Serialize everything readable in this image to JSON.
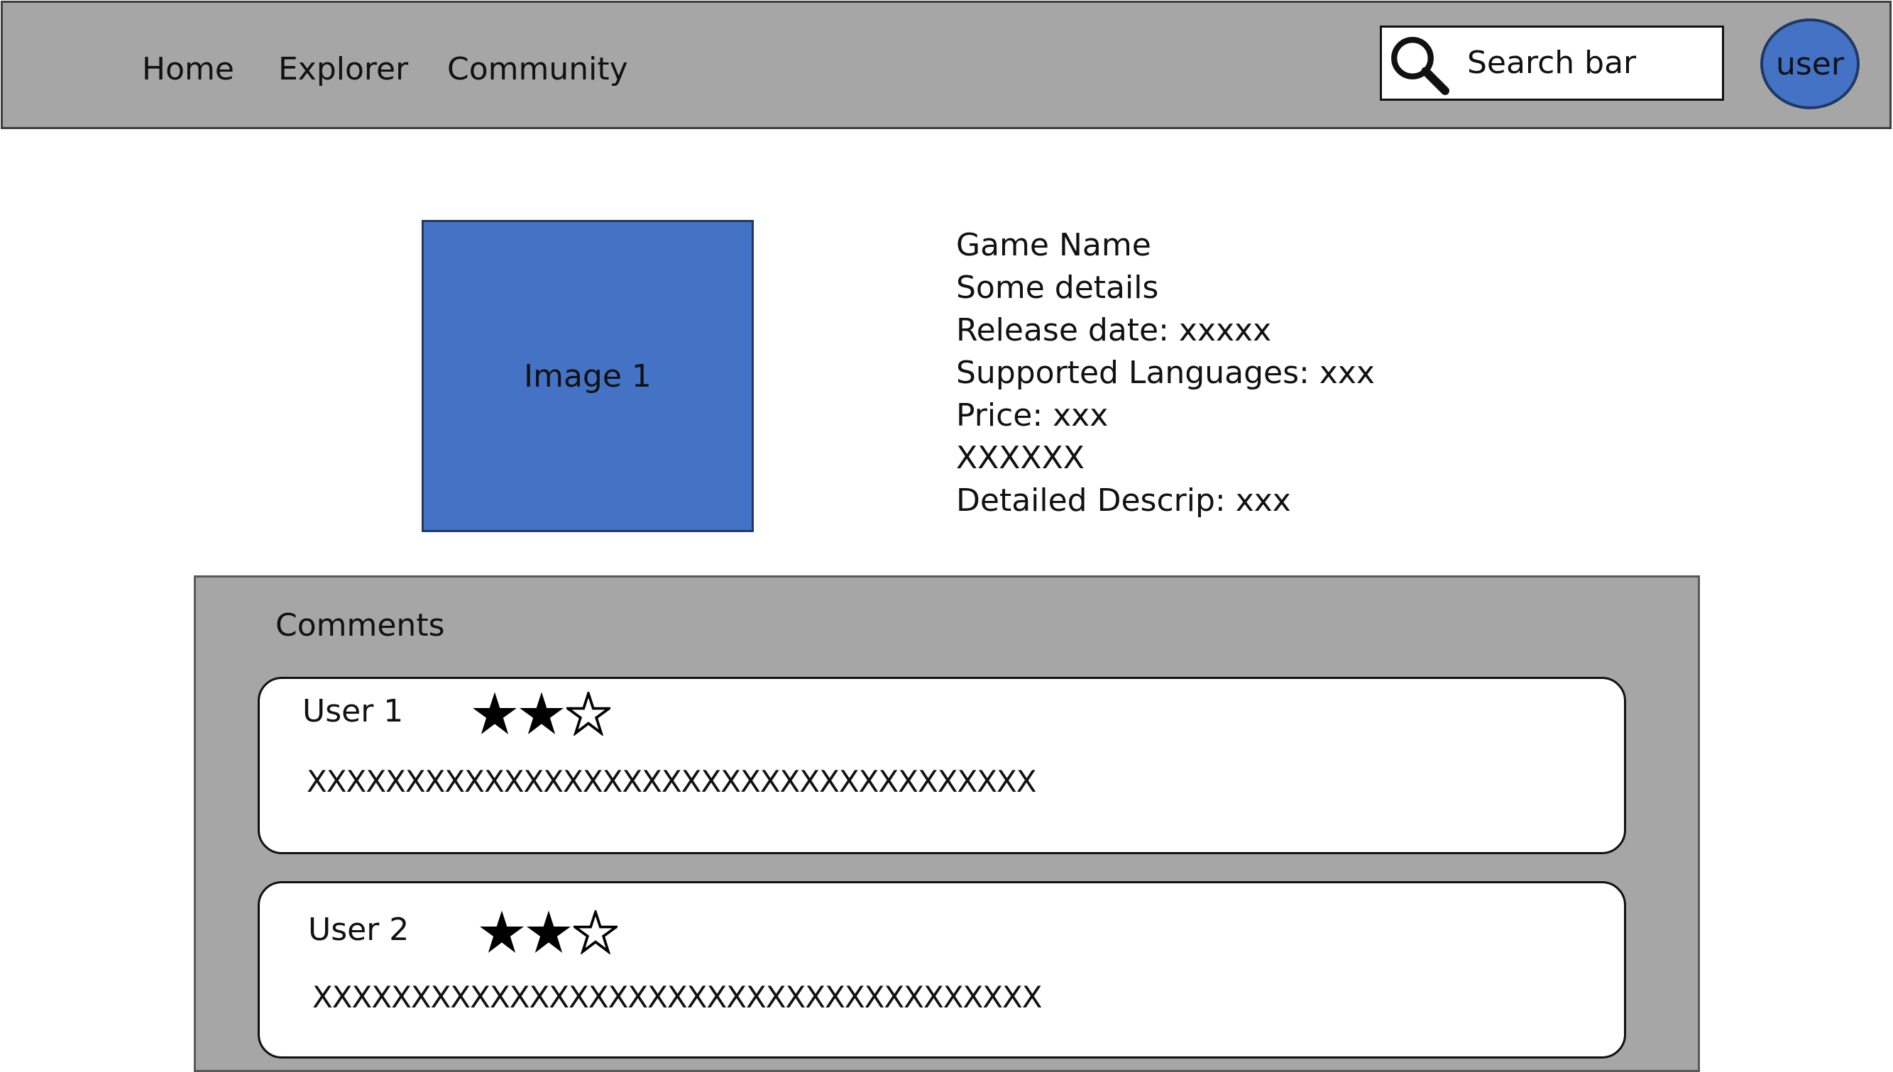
{
  "nav": {
    "links": [
      {
        "label": "Home"
      },
      {
        "label": "Explorer"
      },
      {
        "label": "Community"
      }
    ],
    "search": {
      "placeholder": "Search bar",
      "icon": "search-icon"
    },
    "user": {
      "label": "user"
    }
  },
  "game": {
    "image_label": "Image 1",
    "details": [
      "Game Name",
      "Some details",
      "Release date: xxxxx",
      "Supported Languages: xxx",
      "Price: xxx",
      "XXXXXX",
      "Detailed Descrip: xxx"
    ]
  },
  "comments": {
    "title": "Comments",
    "items": [
      {
        "user": "User 1",
        "rating": 2,
        "max_rating": 3,
        "text": "XXXXXXXXXXXXXXXXXXXXXXXXXXXXXXXXXXXXX"
      },
      {
        "user": "User 2",
        "rating": 2,
        "max_rating": 3,
        "text": "XXXXXXXXXXXXXXXXXXXXXXXXXXXXXXXXXXXXX"
      }
    ]
  },
  "colors": {
    "nav_bg": "#a6a6a6",
    "accent_blue": "#4472c4",
    "panel_bg": "#a6a6a6",
    "card_bg": "#ffffff"
  }
}
